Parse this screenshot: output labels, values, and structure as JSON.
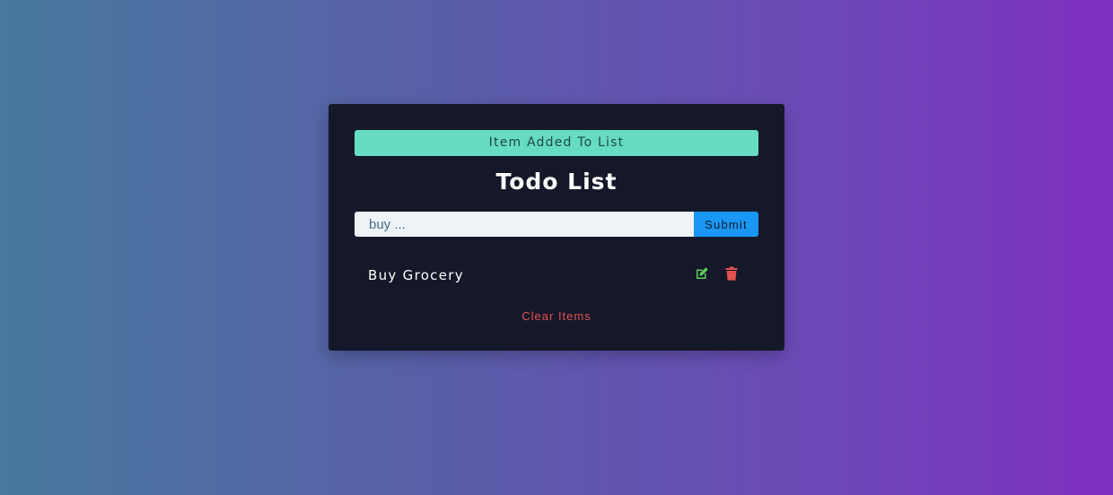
{
  "alert": {
    "text": "Item Added To List",
    "color": "#66dcc2"
  },
  "title": "Todo List",
  "form": {
    "input_placeholder": "buy ...",
    "input_value": "",
    "submit_label": "Submit"
  },
  "items": [
    {
      "label": "Buy Grocery",
      "edit_icon": "edit-icon",
      "delete_icon": "trash-icon"
    }
  ],
  "clear_label": "Clear Items",
  "colors": {
    "card_background": "#151829",
    "submit": "#1a96f5",
    "edit": "#5ccc58",
    "delete": "#e2514e",
    "gradient_start": "#47789e",
    "gradient_end": "#7e2fc0"
  }
}
